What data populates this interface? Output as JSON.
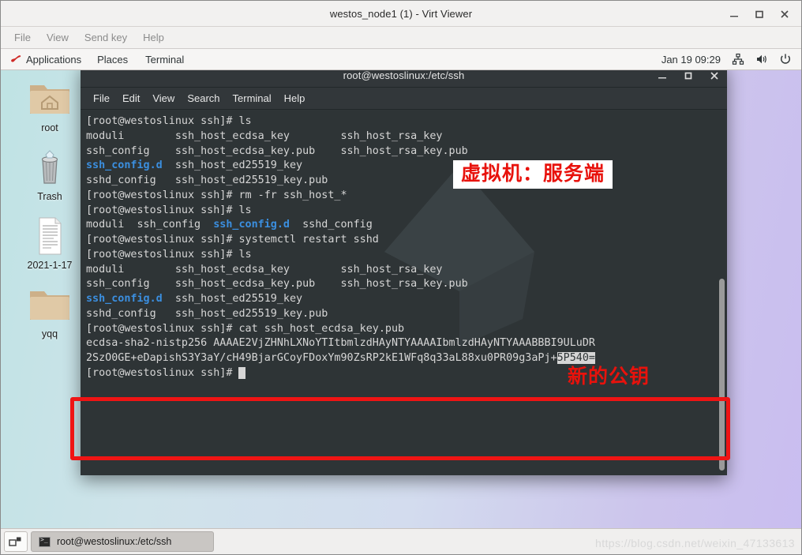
{
  "viewer": {
    "title": "westos_node1 (1) - Virt Viewer",
    "menu": [
      "File",
      "View",
      "Send key",
      "Help"
    ],
    "window_buttons": [
      "minimize-icon",
      "maximize-icon",
      "close-icon"
    ]
  },
  "gnome_panel": {
    "applications": "Applications",
    "places": "Places",
    "terminal": "Terminal",
    "clock": "Jan 19  09:29",
    "tray": [
      "network-icon",
      "volume-icon",
      "power-icon"
    ]
  },
  "desktop": {
    "icons": [
      {
        "label": "root",
        "icon": "home-folder-icon"
      },
      {
        "label": "Trash",
        "icon": "trash-icon"
      },
      {
        "label": "2021-1-17",
        "icon": "document-icon"
      },
      {
        "label": "yqq",
        "icon": "folder-icon"
      }
    ]
  },
  "terminal": {
    "title": "root@westoslinux:/etc/ssh",
    "menu": [
      "File",
      "Edit",
      "View",
      "Search",
      "Terminal",
      "Help"
    ],
    "window_buttons": [
      "minimize-icon",
      "maximize-icon",
      "close-icon"
    ],
    "prompt": "[root@westoslinux ssh]# ",
    "lines": [
      {
        "segments": [
          {
            "t": "[root@westoslinux ssh]# ls"
          }
        ]
      },
      {
        "segments": [
          {
            "t": "moduli        ssh_host_ecdsa_key        ssh_host_rsa_key"
          }
        ]
      },
      {
        "segments": [
          {
            "t": "ssh_config    ssh_host_ecdsa_key.pub    ssh_host_rsa_key.pub"
          }
        ]
      },
      {
        "segments": [
          {
            "t": "ssh_config.d",
            "c": "blue"
          },
          {
            "t": "  ssh_host_ed25519_key"
          }
        ]
      },
      {
        "segments": [
          {
            "t": "sshd_config   ssh_host_ed25519_key.pub"
          }
        ]
      },
      {
        "segments": [
          {
            "t": "[root@westoslinux ssh]# rm -fr ssh_host_*"
          }
        ]
      },
      {
        "segments": [
          {
            "t": "[root@westoslinux ssh]# ls"
          }
        ]
      },
      {
        "segments": [
          {
            "t": "moduli  ssh_config  "
          },
          {
            "t": "ssh_config.d",
            "c": "blue"
          },
          {
            "t": "  sshd_config"
          }
        ]
      },
      {
        "segments": [
          {
            "t": "[root@westoslinux ssh]# systemctl restart sshd"
          }
        ]
      },
      {
        "segments": [
          {
            "t": "[root@westoslinux ssh]# ls"
          }
        ]
      },
      {
        "segments": [
          {
            "t": "moduli        ssh_host_ecdsa_key        ssh_host_rsa_key"
          }
        ]
      },
      {
        "segments": [
          {
            "t": "ssh_config    ssh_host_ecdsa_key.pub    ssh_host_rsa_key.pub"
          }
        ]
      },
      {
        "segments": [
          {
            "t": "ssh_config.d",
            "c": "blue"
          },
          {
            "t": "  ssh_host_ed25519_key"
          }
        ]
      },
      {
        "segments": [
          {
            "t": "sshd_config   ssh_host_ed25519_key.pub"
          }
        ]
      },
      {
        "segments": [
          {
            "t": "[root@westoslinux ssh]# cat ssh_host_ecdsa_key.pub"
          }
        ]
      },
      {
        "segments": [
          {
            "t": "ecdsa-sha2-nistp256 AAAAE2VjZHNhLXNoYTItbmlzdHAyNTYAAAAIbmlzdHAyNTYAAABBBI9ULuDR"
          }
        ]
      },
      {
        "segments": [
          {
            "t": "2SzO0GE+eDapishS3Y3aY/cH49BjarGCoyFDoxYm90ZsRP2kE1WFq8q33aL88xu0PR09g3aPj+"
          },
          {
            "t": "5P540=",
            "c": "selected"
          }
        ]
      },
      {
        "segments": [
          {
            "t": "[root@westoslinux ssh]# "
          },
          {
            "t": " ",
            "c": "cursor"
          }
        ]
      }
    ]
  },
  "annotations": {
    "server_label": "虚拟机：服务端",
    "new_key_label": "新的公钥",
    "box_color": "#ef1414",
    "text_color": "#e8120c"
  },
  "taskbar": {
    "show_desktop": "show-desktop-icon",
    "task_label": "root@westoslinux:/etc/ssh",
    "task_icon": "terminal-icon"
  },
  "watermark": "https://blog.csdn.net/weixin_47133613"
}
